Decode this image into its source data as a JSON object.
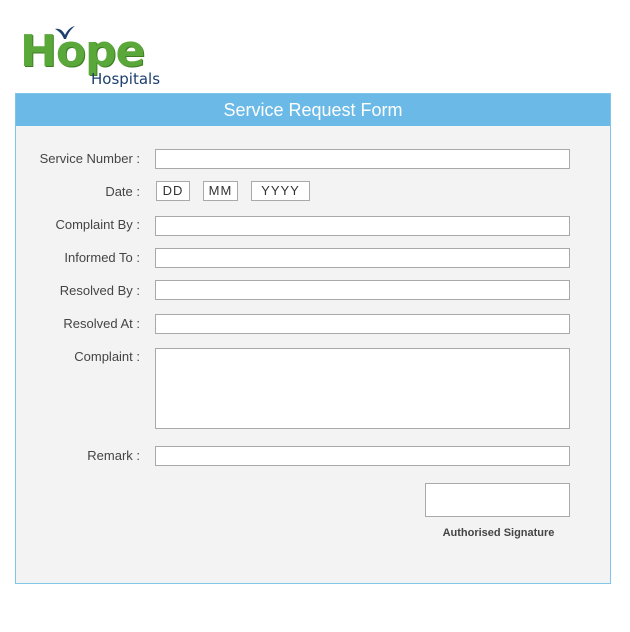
{
  "brand": {
    "name": "Hope",
    "subtitle": "Hospitals"
  },
  "form": {
    "title": "Service Request Form",
    "service_number_label": "Service Number :",
    "date_label": "Date :",
    "date_dd_placeholder": "DD",
    "date_mm_placeholder": "MM",
    "date_yyyy_placeholder": "YYYY",
    "complaint_by_label": "Complaint By :",
    "informed_to_label": "Informed To :",
    "resolved_by_label": "Resolved By :",
    "resolved_at_label": "Resolved At :",
    "complaint_label": "Complaint :",
    "remark_label": "Remark :",
    "signature_label": "Authorised Signature"
  },
  "colors": {
    "header_bg": "#6ab9e7",
    "panel_bg": "#f3f3f3",
    "brand_green": "#5aa73a",
    "brand_navy": "#1c3f6e"
  }
}
